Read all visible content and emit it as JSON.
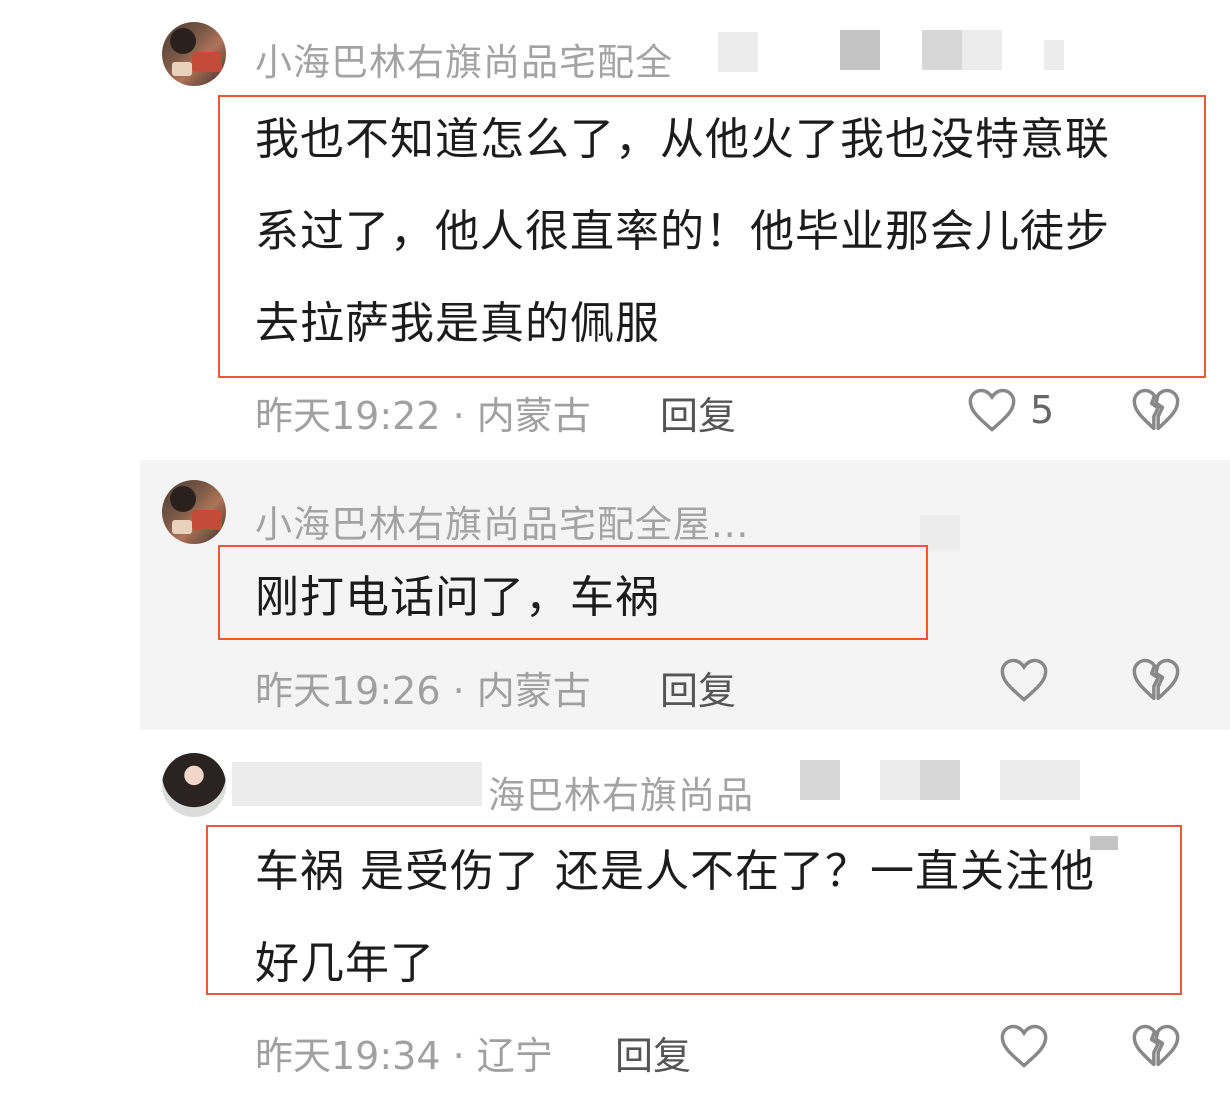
{
  "comments": [
    {
      "username": "小海巴林右旗尚品宅配全",
      "content_lines": [
        "我也不知道怎么了，从他火了我也没特意联",
        "系过了，他人很直率的！他毕业那会儿徒步",
        "去拉萨我是真的佩服"
      ],
      "meta": "昨天19:22 · 内蒙古",
      "reply": "回复",
      "likes": "5",
      "like_icon": "heart-outline-icon",
      "dislike_icon": "broken-heart-icon"
    },
    {
      "username": "小海巴林右旗尚品宅配全屋...",
      "content_lines": [
        "刚打电话问了，车祸"
      ],
      "meta": "昨天19:26 · 内蒙古",
      "reply": "回复",
      "likes": "",
      "like_icon": "heart-outline-icon",
      "dislike_icon": "broken-heart-icon"
    },
    {
      "username": "海巴林右旗尚品",
      "content_lines": [
        "车祸 是受伤了 还是人不在了？一直关注他",
        "好几年了"
      ],
      "meta": "昨天19:34 · 辽宁",
      "reply": "回复",
      "likes": "",
      "like_icon": "heart-outline-icon",
      "dislike_icon": "broken-heart-icon"
    }
  ],
  "colors": {
    "highlight_border": "#e8593a",
    "meta_text": "#a0a0a0",
    "body_text": "#1c1c1c"
  }
}
